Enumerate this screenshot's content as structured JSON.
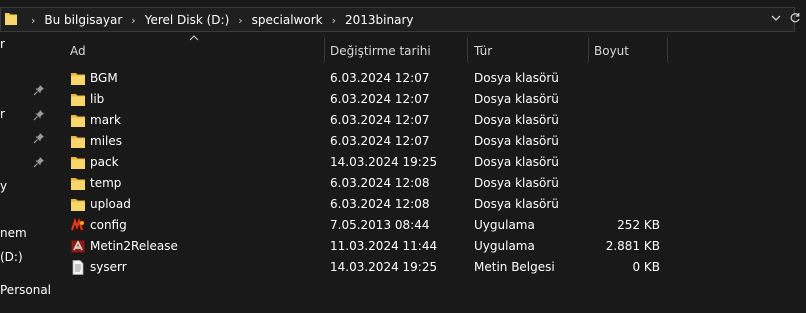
{
  "address_bar": {
    "breadcrumbs": [
      "Bu bilgisayar",
      "Yerel Disk (D:)",
      "specialwork",
      "2013binary"
    ],
    "separator": "›",
    "dropdown_icon": "chevron-down-icon",
    "refresh_icon": "refresh-icon"
  },
  "sidebar": {
    "fragments": [
      "r",
      "r",
      "y",
      "nem",
      "(D:)",
      "Personal"
    ]
  },
  "columns": {
    "name": "Ad",
    "date": "Değiştirme tarihi",
    "type": "Tür",
    "size": "Boyut"
  },
  "files": [
    {
      "name": "BGM",
      "date": "6.03.2024 12:07",
      "type": "Dosya klasörü",
      "size": "",
      "icon": "folder-icon"
    },
    {
      "name": "lib",
      "date": "6.03.2024 12:07",
      "type": "Dosya klasörü",
      "size": "",
      "icon": "folder-icon"
    },
    {
      "name": "mark",
      "date": "6.03.2024 12:07",
      "type": "Dosya klasörü",
      "size": "",
      "icon": "folder-icon"
    },
    {
      "name": "miles",
      "date": "6.03.2024 12:07",
      "type": "Dosya klasörü",
      "size": "",
      "icon": "folder-icon"
    },
    {
      "name": "pack",
      "date": "14.03.2024 19:25",
      "type": "Dosya klasörü",
      "size": "",
      "icon": "folder-icon"
    },
    {
      "name": "temp",
      "date": "6.03.2024 12:08",
      "type": "Dosya klasörü",
      "size": "",
      "icon": "folder-icon"
    },
    {
      "name": "upload",
      "date": "6.03.2024 12:08",
      "type": "Dosya klasörü",
      "size": "",
      "icon": "folder-icon"
    },
    {
      "name": "config",
      "date": "7.05.2013 08:44",
      "type": "Uygulama",
      "size": "252 KB",
      "icon": "config-app-icon"
    },
    {
      "name": "Metin2Release",
      "date": "11.03.2024 11:44",
      "type": "Uygulama",
      "size": "2.881 KB",
      "icon": "metin2-app-icon"
    },
    {
      "name": "syserr",
      "date": "14.03.2024 19:25",
      "type": "Metin Belgesi",
      "size": "0 KB",
      "icon": "text-document-icon"
    }
  ],
  "colors": {
    "background": "#191919",
    "folder": "#f5c84c",
    "text": "#ffffff"
  }
}
